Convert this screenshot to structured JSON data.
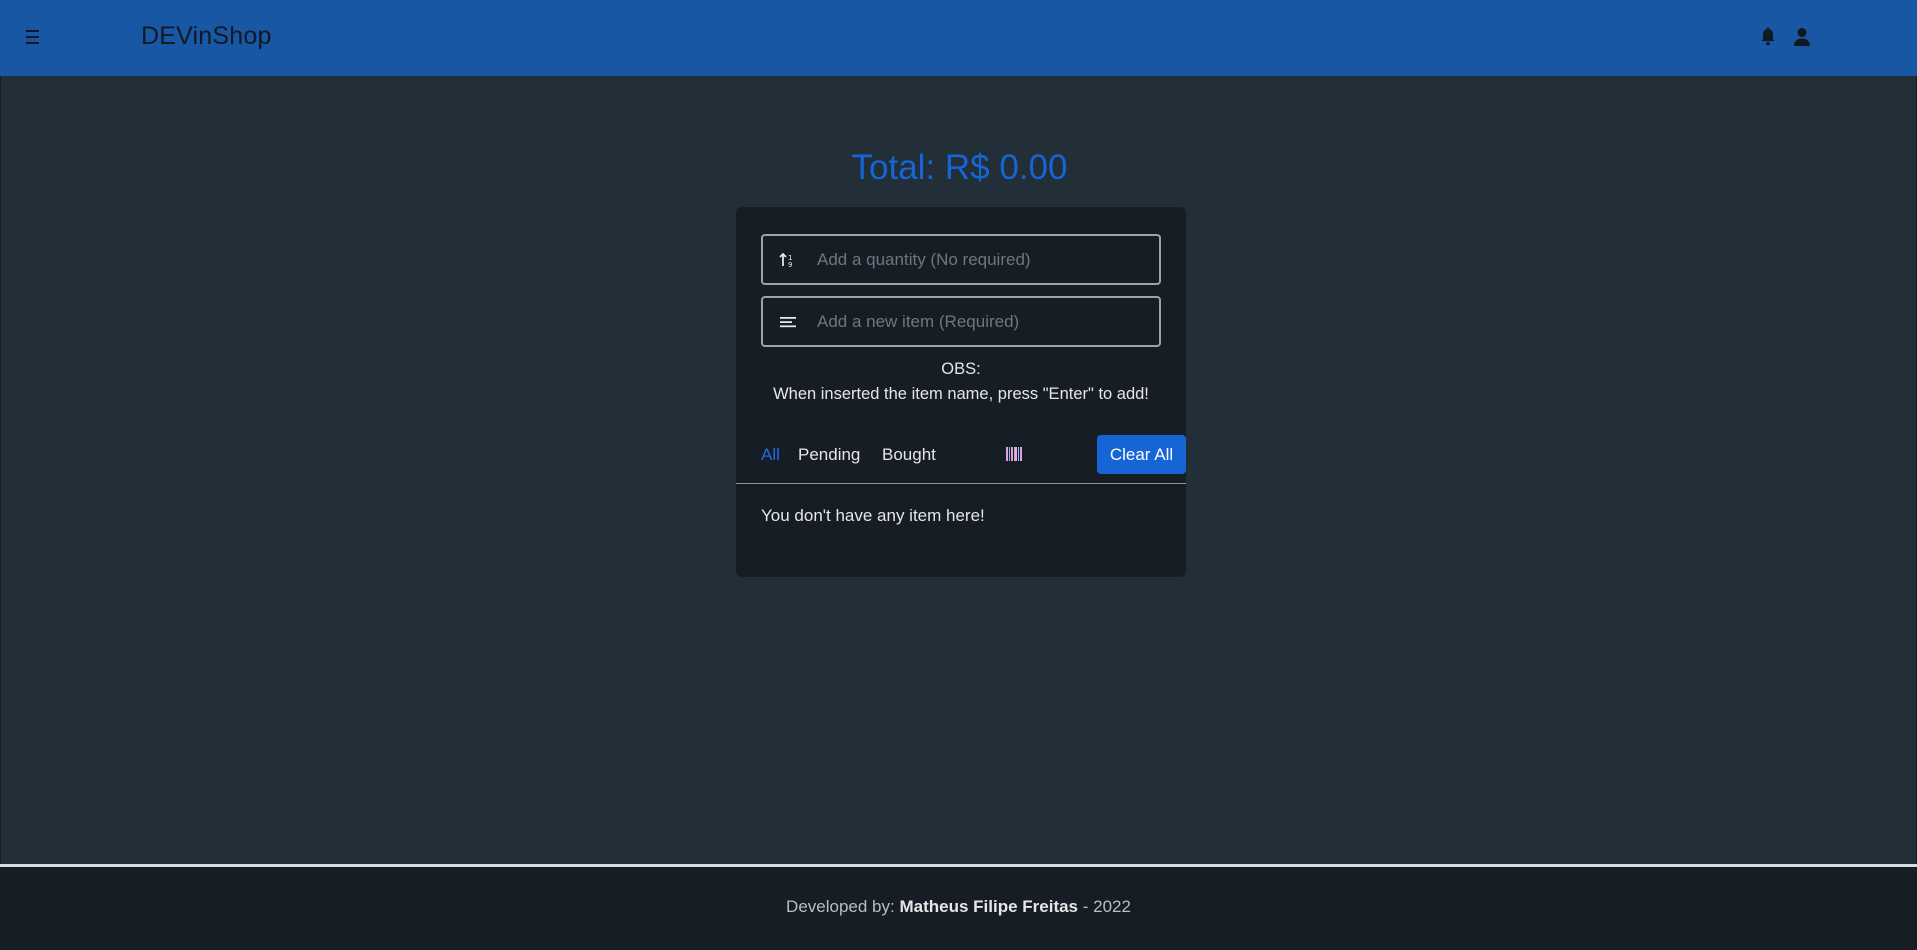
{
  "header": {
    "brand": "DEVinShop",
    "menu_icon": "hamburger-menu-icon",
    "notification_icon": "bell-icon",
    "account_icon": "user-icon"
  },
  "summary": {
    "total": "Total: R$ 0.00"
  },
  "form": {
    "quantity_placeholder": "Add a quantity (No required)",
    "quantity_value": "",
    "quantity_icon": "sort-numeric-icon",
    "item_placeholder": "Add a new item (Required)",
    "item_value": "",
    "item_icon": "lines-icon",
    "obs_title": "OBS:",
    "obs_text": "When inserted the item name, press \"Enter\" to add!"
  },
  "filters": {
    "tabs": [
      {
        "label": "All",
        "active": true
      },
      {
        "label": "Pending",
        "active": false
      },
      {
        "label": "Bought",
        "active": false
      }
    ],
    "barcode_icon": "barcode-icon",
    "clear_label": "Clear All"
  },
  "list": {
    "empty_message": "You don't have any item here!"
  },
  "footer": {
    "prefix": "Developed by:",
    "author": "Matheus Filipe Freitas",
    "suffix": "- 2022"
  },
  "colors": {
    "header_bg": "#1757a4",
    "accent": "#1565d6",
    "page_bg": "#222e38",
    "card_bg": "#161d25"
  }
}
